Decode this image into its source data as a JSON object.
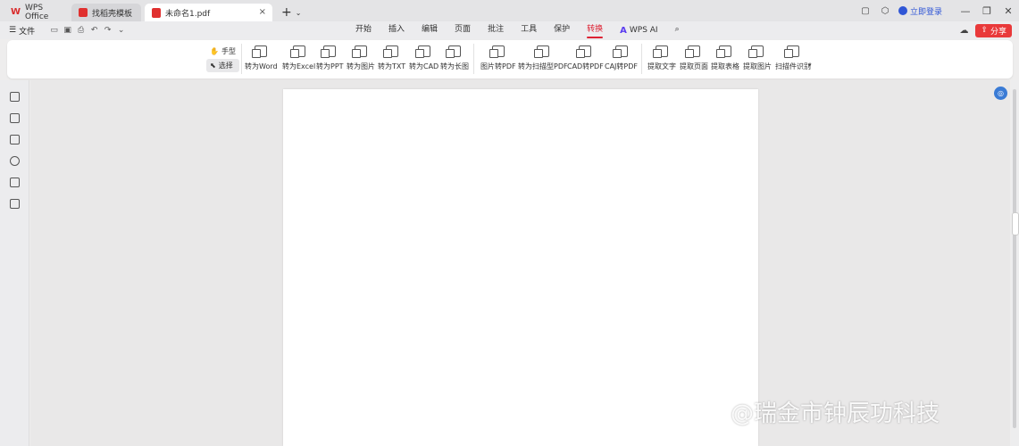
{
  "tabs": [
    {
      "label": "WPS Office"
    },
    {
      "label": "找稻壳模板"
    },
    {
      "label": "未命名1.pdf"
    }
  ],
  "titlebar": {
    "login": "立即登录"
  },
  "menubar": {
    "file": "文件",
    "tabs": [
      "开始",
      "插入",
      "编辑",
      "页面",
      "批注",
      "工具",
      "保护",
      "转换"
    ],
    "active_tab": "转换",
    "wps_ai": "WPS AI",
    "share": "分享"
  },
  "ribbon": {
    "hand": "手型",
    "select": "选择",
    "buttons": [
      "转为Word",
      "转为Excel",
      "转为PPT",
      "转为图片",
      "转为TXT",
      "转为CAD",
      "转为长图",
      "图片转PDF",
      "转为扫描型PDF",
      "CAD转PDF",
      "CAJ转PDF",
      "提取文字",
      "提取页面",
      "提取表格",
      "提取图片",
      "扫描件识别"
    ]
  },
  "watermark": "@瑞金市钟辰功科技",
  "colors": {
    "accent": "#d92b2b",
    "share": "#e9393a",
    "link": "#3056d6"
  }
}
